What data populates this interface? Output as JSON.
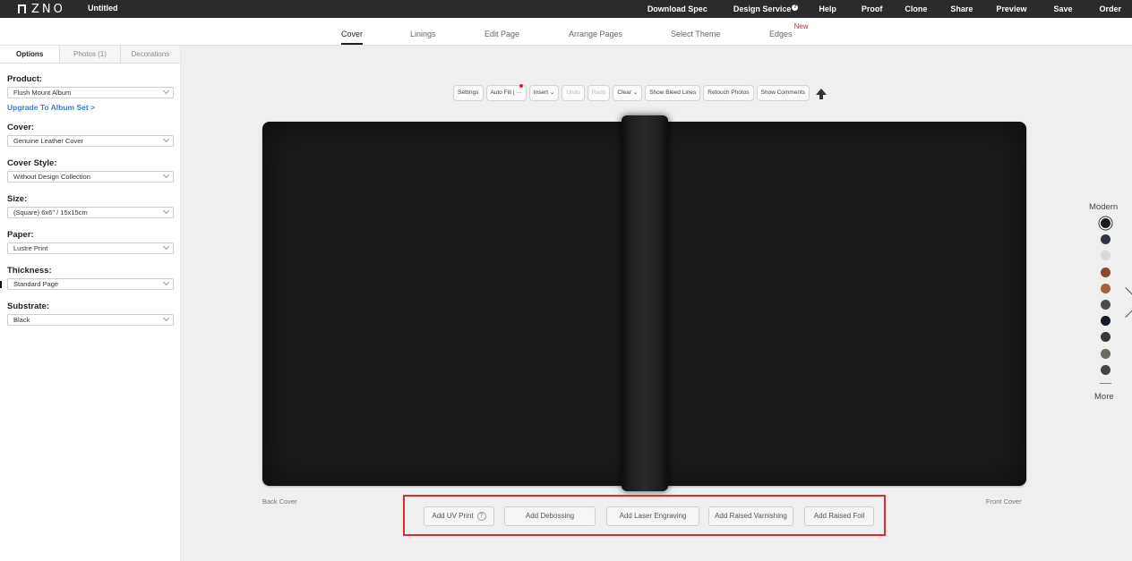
{
  "app": {
    "logo_text": "ZNO",
    "doc_title": "Untitled"
  },
  "topnav": [
    {
      "label": "Download Spec",
      "name": "download-spec-link"
    },
    {
      "label": "Design Service",
      "name": "design-service-link"
    },
    {
      "label": "Help",
      "name": "help-link"
    },
    {
      "label": "Proof",
      "name": "proof-link"
    },
    {
      "label": "Clone",
      "name": "clone-link"
    },
    {
      "label": "Share",
      "name": "share-link"
    },
    {
      "label": "Preview",
      "name": "preview-link"
    },
    {
      "label": "Save",
      "name": "save-link"
    },
    {
      "label": "Order",
      "name": "order-link"
    }
  ],
  "tabs": [
    {
      "label": "Cover",
      "active": true
    },
    {
      "label": "Linings"
    },
    {
      "label": "Edit Page"
    },
    {
      "label": "Arrange Pages"
    },
    {
      "label": "Select Theme"
    },
    {
      "label": "Edges",
      "badge": "New"
    }
  ],
  "left_panel": {
    "tabs": [
      "Options",
      "Photos (1)",
      "Decorations"
    ],
    "fields": [
      {
        "label": "Product:",
        "value": "Flush Mount Album"
      },
      {
        "label": "Cover:",
        "value": "Genuine Leather Cover"
      },
      {
        "label": "Cover Style:",
        "value": "Without Design Collection"
      },
      {
        "label": "Size:",
        "value": "(Square) 6x6\" / 15x15cm"
      },
      {
        "label": "Paper:",
        "value": "Lustre Print"
      },
      {
        "label": "Thickness:",
        "value": "Standard Page"
      },
      {
        "label": "Substrate:",
        "value": "Black"
      }
    ],
    "upgrade_link": "Upgrade To Album Set >"
  },
  "toolbar": {
    "settings": "Settings",
    "auto_fill": "Auto Fill",
    "auto_fill_more": "···",
    "insert": "Insert ⌄",
    "undo": "Undo",
    "redo": "Redo",
    "clear": "Clear ⌄",
    "show_bleed": "Show Bleed Lines",
    "retouch": "Retouch Photos",
    "show_comments": "Show Comments"
  },
  "canvas": {
    "back_cover": "Back Cover",
    "front_cover": "Front Cover",
    "cover_color": "#1b1b1d"
  },
  "actions": {
    "uv_print": "Add UV Print",
    "uv_help": "?",
    "debossing": "Add Debossing",
    "laser": "Add Laser Engraving",
    "varnish": "Add Raised Varnishing",
    "foil": "Add Raised Foil"
  },
  "swatches": {
    "title": "Modern",
    "more": "More",
    "colors": [
      "#1a1a1a",
      "#2f3441",
      "#d9d9d6",
      "#8a4a2c",
      "#a8613a",
      "#4a4c52",
      "#141a2a",
      "#3b3935",
      "#6e6a61",
      "#47423f"
    ]
  }
}
